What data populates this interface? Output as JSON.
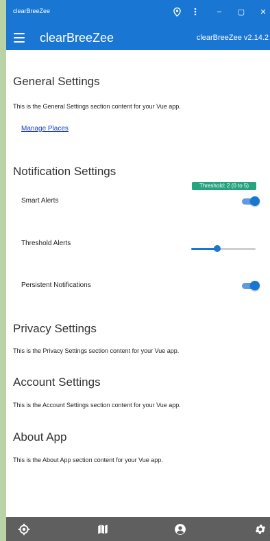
{
  "window": {
    "title": "clearBreeZee",
    "minimize_glyph": "–",
    "maximize_glyph": "▢",
    "close_glyph": "✕"
  },
  "header": {
    "title": "clearBreeZee",
    "version": "clearBreeZee v2.14.2"
  },
  "sections": {
    "general": {
      "heading": "General Settings",
      "text": "This is the General Settings section content for your Vue app.",
      "link": "Manage Places"
    },
    "notifications": {
      "heading": "Notification Settings",
      "smart_alerts": {
        "label": "Smart Alerts",
        "enabled": true
      },
      "threshold_alerts": {
        "label": "Threshold Alerts",
        "badge": "Threshold: 2 (0 to 5)",
        "value": 2,
        "min": 0,
        "max": 5
      },
      "persistent": {
        "label": "Persistent Notifications",
        "enabled": true
      }
    },
    "privacy": {
      "heading": "Privacy Settings",
      "text": "This is the Privacy Settings section content for your Vue app."
    },
    "account": {
      "heading": "Account Settings",
      "text": "This is the Account Settings section content for your Vue app."
    },
    "about": {
      "heading": "About App",
      "text": "This is the About App section content for your Vue app."
    }
  },
  "bottom_nav": [
    "location-target-icon",
    "map-icon",
    "account-icon",
    "settings-gear-icon"
  ],
  "colors": {
    "primary": "#1976d2",
    "toggle_track": "#5e9be0",
    "badge": "#27a37f",
    "bottom_nav": "#5f5f5f",
    "frame": "#b9d3a6"
  }
}
